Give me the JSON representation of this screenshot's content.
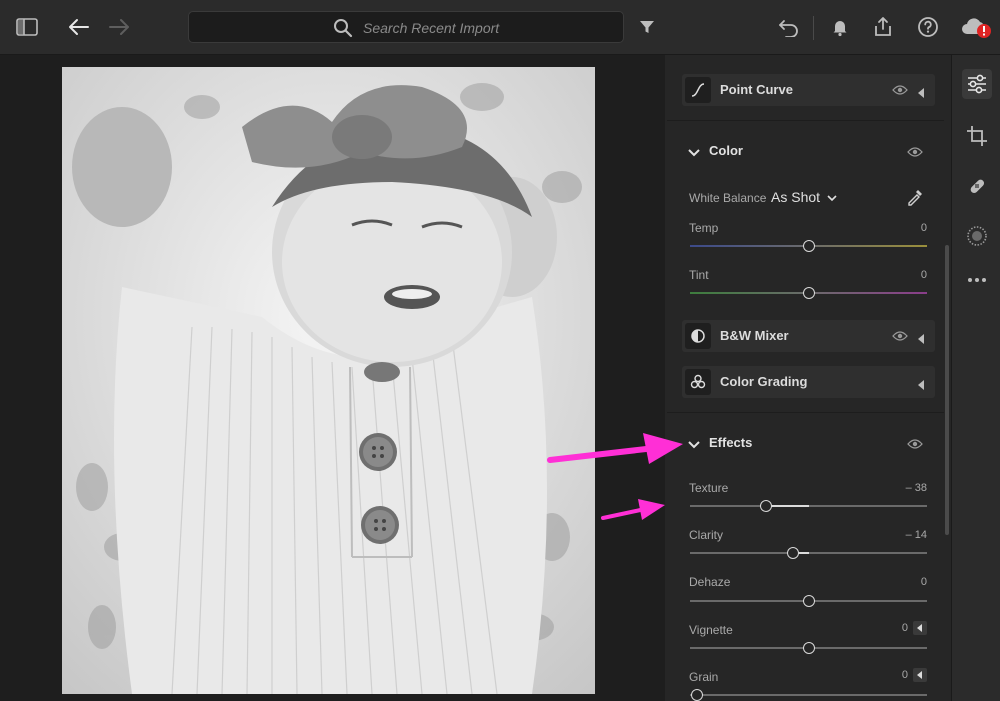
{
  "toolbar": {
    "search_placeholder": "Search Recent Import"
  },
  "panel": {
    "point_curve": {
      "title": "Point Curve"
    },
    "color": {
      "title": "Color",
      "white_balance_label": "White Balance",
      "white_balance_value": "As Shot",
      "sliders": [
        {
          "label": "Temp",
          "value": "0",
          "position": 0.5
        },
        {
          "label": "Tint",
          "value": "0",
          "position": 0.5
        }
      ]
    },
    "bw_mixer": {
      "title": "B&W Mixer"
    },
    "color_grading": {
      "title": "Color Grading"
    },
    "effects": {
      "title": "Effects",
      "sliders": [
        {
          "label": "Texture",
          "value": "– 38",
          "position": 0.31
        },
        {
          "label": "Clarity",
          "value": "– 14",
          "position": 0.43
        },
        {
          "label": "Dehaze",
          "value": "0",
          "position": 0.5
        },
        {
          "label": "Vignette",
          "value": "0",
          "position": 0.5
        },
        {
          "label": "Grain",
          "value": "0",
          "position": 0.0
        }
      ]
    }
  },
  "colors": {
    "accent_annotation": "#ff2fd6",
    "alert": "#e02424"
  }
}
